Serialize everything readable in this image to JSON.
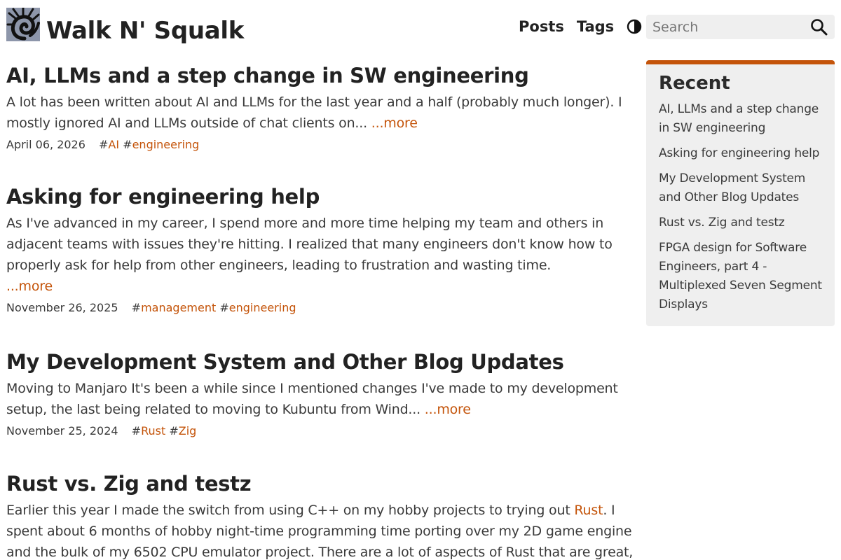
{
  "header": {
    "site_title": "Walk N' Squalk",
    "nav": {
      "posts": "Posts",
      "tags": "Tags"
    },
    "search_placeholder": "Search"
  },
  "posts": [
    {
      "title": "AI, LLMs and a step change in SW engineering",
      "excerpt": "A lot has been written about AI and LLMs for the last year and a half (probably much longer). I mostly ignored AI and LLMs outside of chat clients on...",
      "more": "...more",
      "date": "April 06, 2026",
      "tags": [
        "AI",
        "engineering"
      ]
    },
    {
      "title": "Asking for engineering help",
      "excerpt": "As I've advanced in my career, I spend more and more time helping my team and others in adjacent teams with issues they're hitting. I realized that many engineers don't know how to properly ask for help from other engineers, leading to frustration and wasting time.",
      "more": "...more",
      "date": "November 26, 2025",
      "tags": [
        "management",
        "engineering"
      ]
    },
    {
      "title": "My Development System and Other Blog Updates",
      "excerpt": "Moving to Manjaro It's been a while since I mentioned changes I've made to my development setup, the last being related to moving to Kubuntu from Wind...",
      "more": "...more",
      "date": "November 25, 2024",
      "tags": [
        "Rust",
        "Zig"
      ]
    },
    {
      "title": "Rust vs. Zig and testz",
      "excerpt_before": "Earlier this year I made the switch from using C++ on my hobby projects to trying out ",
      "excerpt_link": "Rust",
      "excerpt_after": ". I spent about 6 months of hobby night-time programming time porting over my 2D game engine and the bulk of my 6502 CPU emulator project. There are a lot of aspects of Rust that are great,"
    }
  ],
  "sidebar": {
    "title": "Recent",
    "items": [
      "AI, LLMs and a step change in SW engineering",
      "Asking for engineering help",
      "My Development System and Other Blog Updates",
      "Rust vs. Zig and testz",
      "FPGA design for Software Engineers, part 4 - Multiplexed Seven Segment Displays"
    ]
  },
  "colors": {
    "accent": "#c4540a",
    "panel": "#efefef",
    "text": "#2b2b2b"
  }
}
